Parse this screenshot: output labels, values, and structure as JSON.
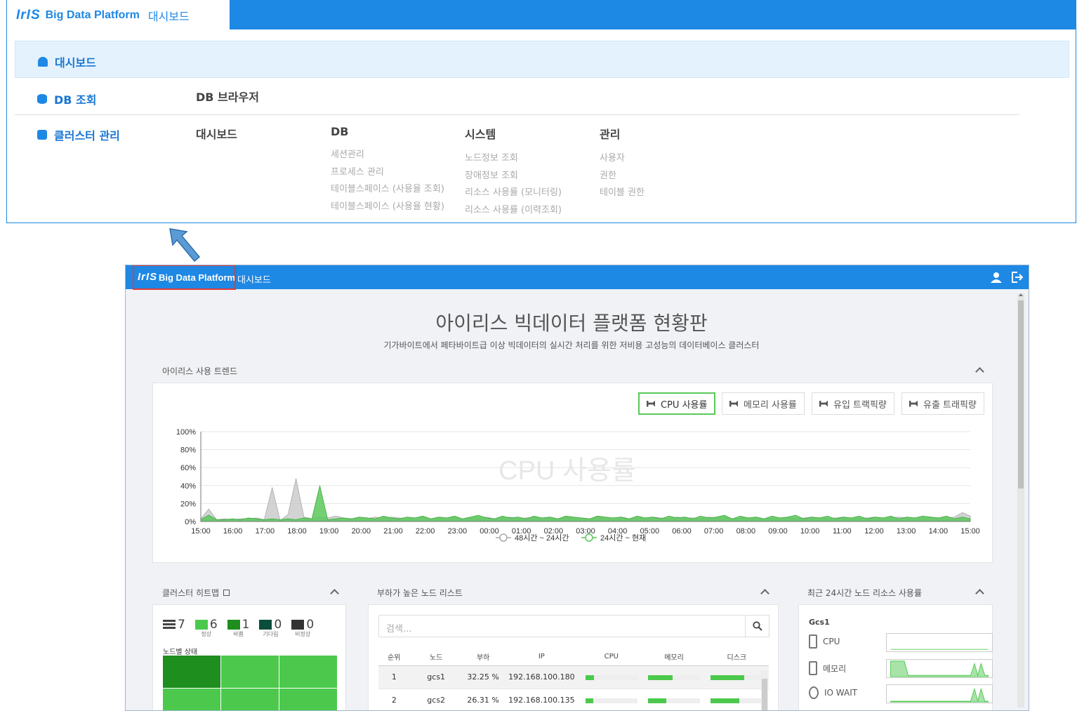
{
  "top_panel": {
    "logo": "IrIS",
    "brand": "Big Data Platform",
    "page": "대시보드",
    "menu": {
      "dashboard": "대시보드",
      "db": {
        "label": "DB 조회",
        "items": [
          "DB 브라우저"
        ]
      },
      "cluster": {
        "label": "클러스터 관리",
        "columns": [
          {
            "heading": "대시보드",
            "items": []
          },
          {
            "heading": "DB",
            "items": [
              "세션관리",
              "프로세스 관리",
              "테이블스페이스 (사용율 조회)",
              "테이블스페이스 (사용율 현황)"
            ]
          },
          {
            "heading": "시스템",
            "items": [
              "노드정보 조회",
              "장애정보 조회",
              "리소스 사용률 (모니터링)",
              "리소스 사용률 (이력조회)"
            ]
          },
          {
            "heading": "관리",
            "items": [
              "사용자",
              "권한",
              "테이블 권한"
            ]
          }
        ]
      }
    }
  },
  "dashboard": {
    "header": {
      "logo": "IrIS",
      "brand": "Big Data Platform",
      "page": "대시보드"
    },
    "title": "아이리스 빅데이터 플랫폼 현황판",
    "subtitle": "기가바이트에서 페타바이트급 이상 빅데이터의 실시간 처리를 위한 저비용 고성능의 데이터베이스 클러스터",
    "trend": {
      "section_label": "아이리스 사용 트렌드",
      "buttons": [
        "CPU 사용률",
        "메모리 사용률",
        "유입 트랙픽량",
        "유출 트래픽량"
      ],
      "active_button": "CPU 사용률",
      "watermark": "CPU 사용률"
    },
    "heatmap": {
      "section_label": "클러스터 히트맵",
      "total": "7",
      "stats": [
        {
          "value": "6",
          "label": "정상",
          "color": "#4cc94c"
        },
        {
          "value": "1",
          "label": "바쁨",
          "color": "#1e8e1e"
        },
        {
          "value": "0",
          "label": "기다림",
          "color": "#0b4d3c"
        },
        {
          "value": "0",
          "label": "비정상",
          "color": "#333333"
        }
      ],
      "grid_title": "노드별 상태"
    },
    "nodes": {
      "section_label": "부하가 높은 노드 리스트",
      "search_placeholder": "검색...",
      "columns": [
        "순위",
        "노드",
        "부하",
        "IP",
        "CPU",
        "메모리",
        "디스크"
      ],
      "rows": [
        {
          "rank": "1",
          "node": "gcs1",
          "load": "32.25 %",
          "ip": "192.168.100.180",
          "cpu": 0.17,
          "mem": 0.47,
          "disk": 0.64
        },
        {
          "rank": "2",
          "node": "gcs2",
          "load": "26.31 %",
          "ip": "192.168.100.135",
          "cpu": 0.15,
          "mem": 0.35,
          "disk": 0.55
        }
      ]
    },
    "resources": {
      "section_label": "최근 24시간 노드 리소스 사용률",
      "host": "Gcs1",
      "metrics": [
        "CPU",
        "메모리",
        "IO WAIT"
      ]
    }
  },
  "chart_data": {
    "type": "area",
    "title": "",
    "xlabel": "",
    "ylabel": "",
    "ylim": [
      0,
      100
    ],
    "y_ticks": [
      "0%",
      "20%",
      "40%",
      "60%",
      "80%",
      "100%"
    ],
    "categories": [
      "15:00",
      "16:00",
      "17:00",
      "18:00",
      "19:00",
      "20:00",
      "21:00",
      "22:00",
      "23:00",
      "00:00",
      "01:00",
      "02:00",
      "03:00",
      "04:00",
      "05:00",
      "06:00",
      "07:00",
      "08:00",
      "09:00",
      "10:00",
      "11:00",
      "12:00",
      "13:00",
      "14:00",
      "15:00"
    ],
    "legend": "bottom",
    "series": [
      {
        "name": "48시간 ~ 24시간",
        "color": "#c8c8c8",
        "values": [
          3,
          14,
          2,
          3,
          2,
          3,
          3,
          4,
          2,
          38,
          1,
          8,
          48,
          5,
          3,
          5,
          4,
          6,
          4,
          3,
          4,
          3,
          5,
          4,
          5,
          4,
          3,
          4,
          5,
          3,
          4,
          4,
          5,
          3,
          4,
          4,
          5,
          3,
          4,
          5,
          3,
          4,
          5,
          4,
          4,
          3,
          5,
          4,
          4,
          3,
          5,
          4,
          4,
          5,
          3,
          4,
          4,
          5,
          4,
          3,
          5,
          4,
          4,
          3,
          5,
          4,
          5,
          3,
          4,
          4,
          5,
          3,
          4,
          4,
          5,
          3,
          4,
          5,
          4,
          3,
          4,
          5,
          3,
          4,
          4,
          5,
          3,
          4,
          5,
          4,
          4,
          3,
          5,
          4,
          4,
          5,
          10,
          6
        ]
      },
      {
        "name": "24시간 ~ 현재",
        "color": "#5ac85a",
        "values": [
          2,
          7,
          2,
          2,
          3,
          2,
          4,
          3,
          2,
          3,
          2,
          3,
          2,
          4,
          3,
          40,
          2,
          3,
          4,
          3,
          5,
          4,
          3,
          6,
          4,
          3,
          5,
          4,
          6,
          3,
          5,
          4,
          6,
          3,
          5,
          7,
          4,
          3,
          6,
          4,
          5,
          3,
          6,
          4,
          5,
          3,
          6,
          5,
          4,
          3,
          6,
          5,
          4,
          5,
          3,
          6,
          4,
          5,
          3,
          6,
          4,
          5,
          3,
          6,
          4,
          5,
          7,
          3,
          6,
          4,
          5,
          3,
          6,
          4,
          5,
          7,
          3,
          5,
          4,
          6,
          3,
          5,
          4,
          6,
          3,
          5,
          4,
          6,
          3,
          5,
          4,
          6,
          5,
          4,
          6,
          3,
          5,
          3
        ]
      }
    ]
  }
}
